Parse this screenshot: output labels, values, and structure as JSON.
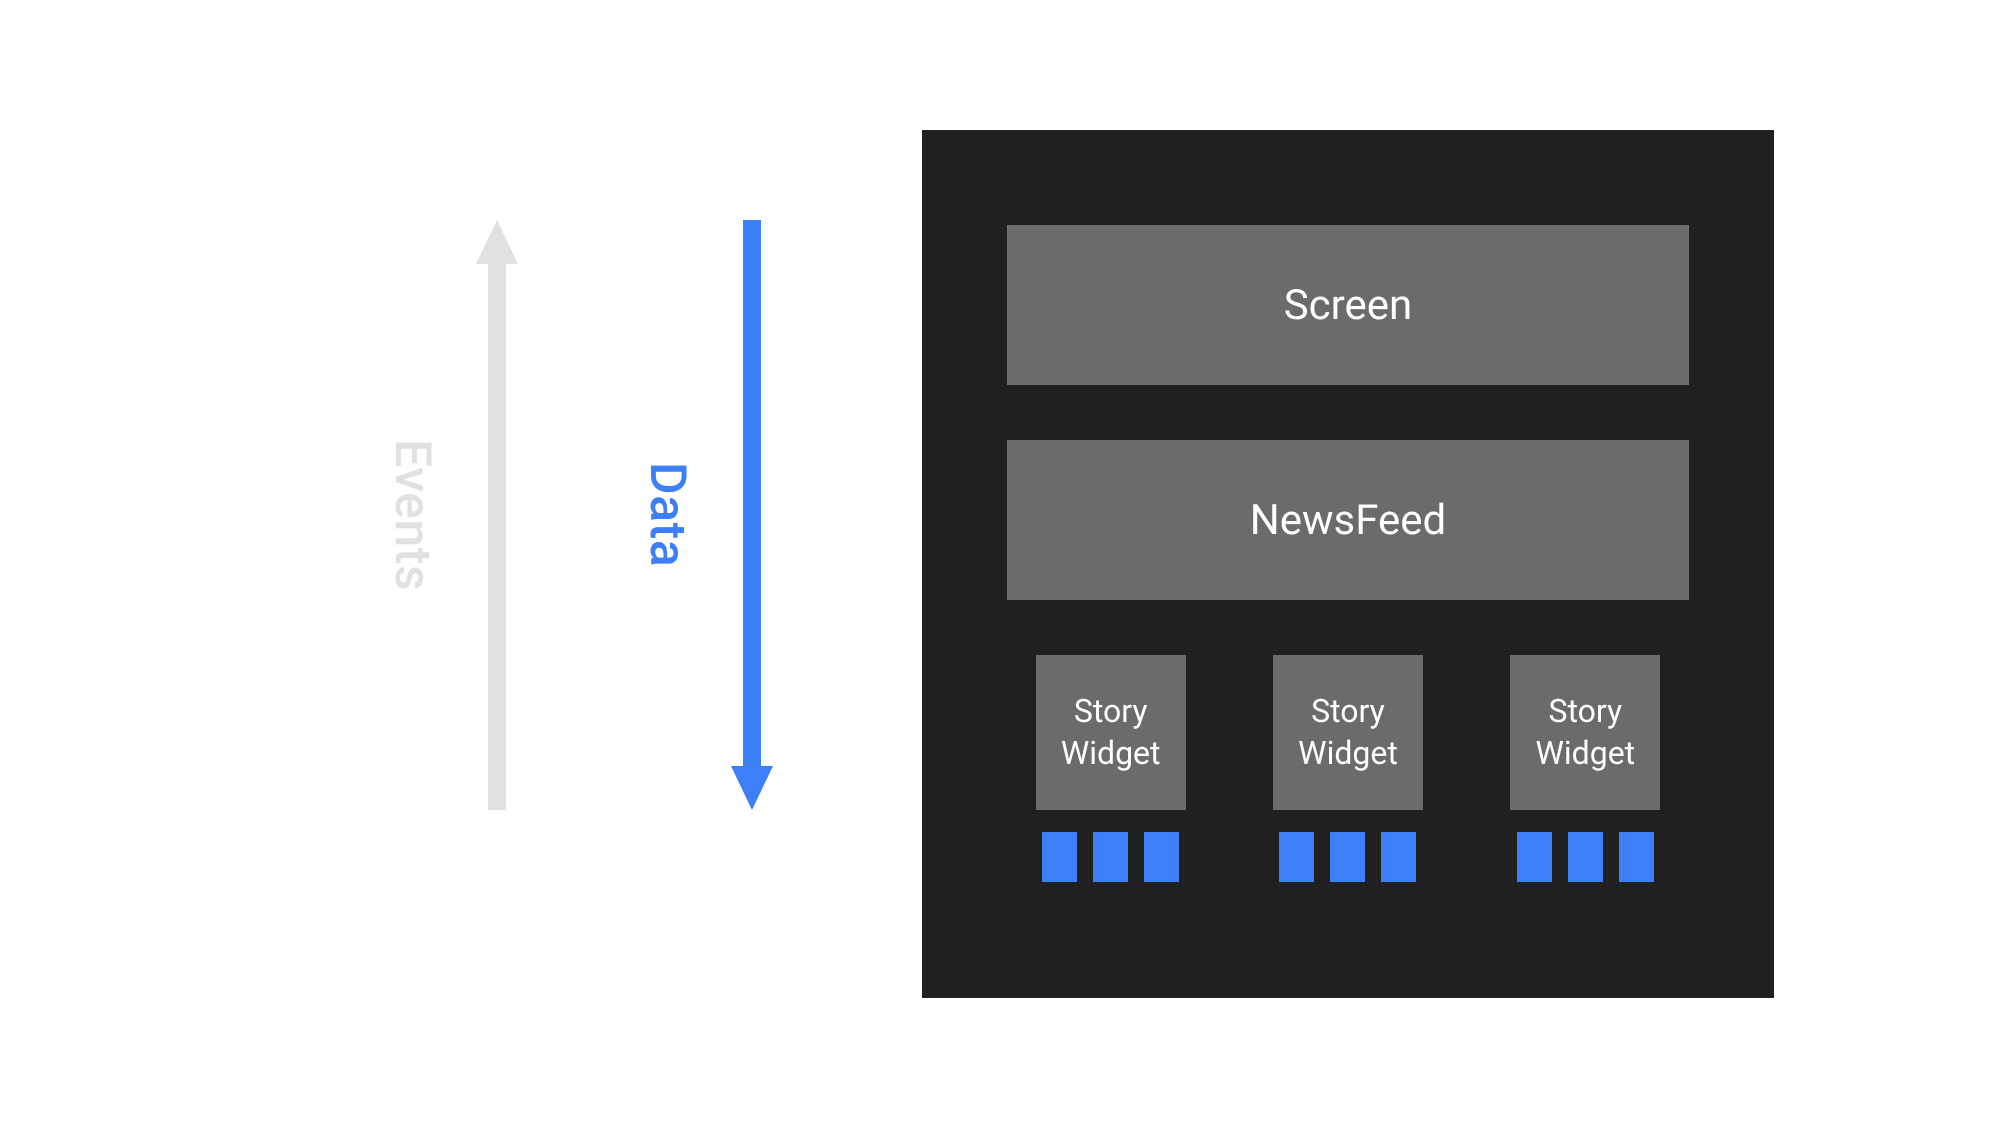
{
  "left": {
    "events_label": "Events",
    "data_label": "Data"
  },
  "right": {
    "screen": "Screen",
    "newsfeed": "NewsFeed",
    "widgets": [
      {
        "line1": "Story",
        "line2": "Widget"
      },
      {
        "line1": "Story",
        "line2": "Widget"
      },
      {
        "line1": "Story",
        "line2": "Widget"
      }
    ]
  },
  "colors": {
    "accent_blue": "#3D7FF8",
    "light_gray": "#E1E1E1",
    "box_gray": "#6B6B6C",
    "dark_bg": "#202022"
  }
}
